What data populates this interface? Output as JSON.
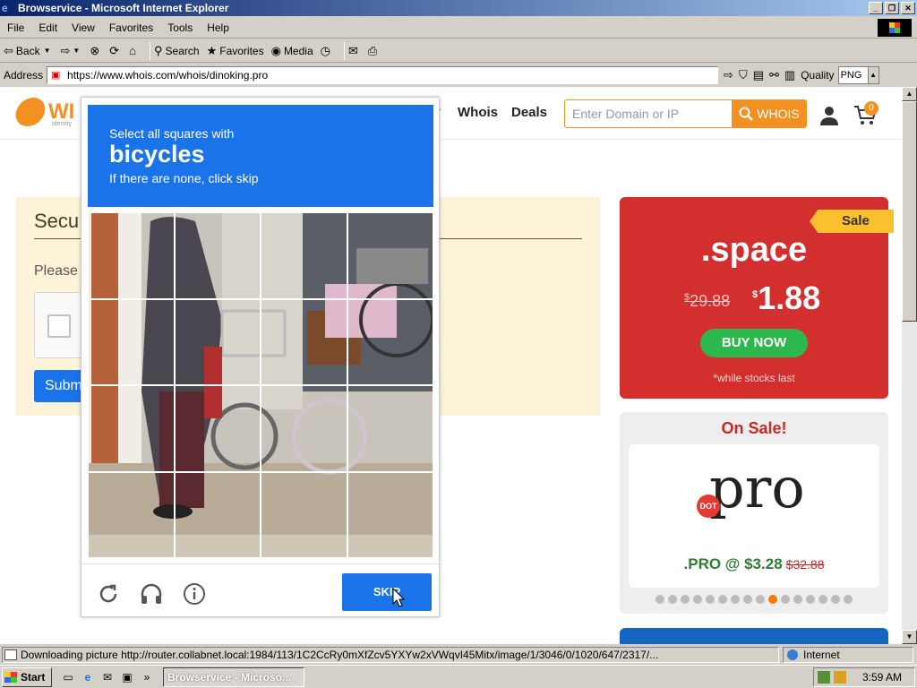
{
  "window": {
    "title": "Browservice - Microsoft Internet Explorer",
    "buttons": [
      "_",
      "❐",
      "✕"
    ]
  },
  "menu": [
    "File",
    "Edit",
    "View",
    "Favorites",
    "Tools",
    "Help"
  ],
  "toolbar": {
    "back": "Back",
    "search": "Search",
    "favorites": "Favorites",
    "media": "Media"
  },
  "address": {
    "label": "Address",
    "url": "https://www.whois.com/whois/dinoking.pro",
    "quality_label": "Quality",
    "quality_value": "PNG"
  },
  "site": {
    "logo_text": "WI",
    "logo_sub": "identity",
    "nav_partial": "y",
    "nav": [
      "Whois",
      "Deals"
    ],
    "search_placeholder": "Enter Domain or IP",
    "search_button": "WHOIS",
    "cart_count": "0"
  },
  "security": {
    "title": "Secu",
    "please": "Please",
    "submit": "Subm"
  },
  "ad_space": {
    "ribbon": "Sale",
    "ext": ".space",
    "old_currency": "$",
    "old_price": "29.88",
    "new_currency": "$",
    "new_price": "1.88",
    "button": "BUY NOW",
    "note": "*while stocks last"
  },
  "ad_pro": {
    "heading": "On Sale!",
    "dot": "DOT",
    "brand": "pro",
    "price": ".PRO @ $3.28",
    "old_price": "$32.88",
    "carousel_count": 16,
    "carousel_active": 9
  },
  "captcha": {
    "line1": "Select all squares with",
    "target": "bicycles",
    "line3": "If there are none, click skip",
    "skip": "SKIP"
  },
  "status": {
    "message": "Downloading picture http://router.collabnet.local:1984/113/1C2CcRy0mXfZcv5YXYw2xVWqvI45Mitx/image/1/3046/0/1020/647/2317/...",
    "zone": "Internet"
  },
  "taskbar": {
    "start": "Start",
    "task": "Browservice - Microso...",
    "time": "3:59 AM",
    "quicklaunch_more": "»"
  },
  "colors": {
    "accent": "#1a73e8",
    "orange": "#f39022",
    "sale_red": "#d32f2f"
  }
}
